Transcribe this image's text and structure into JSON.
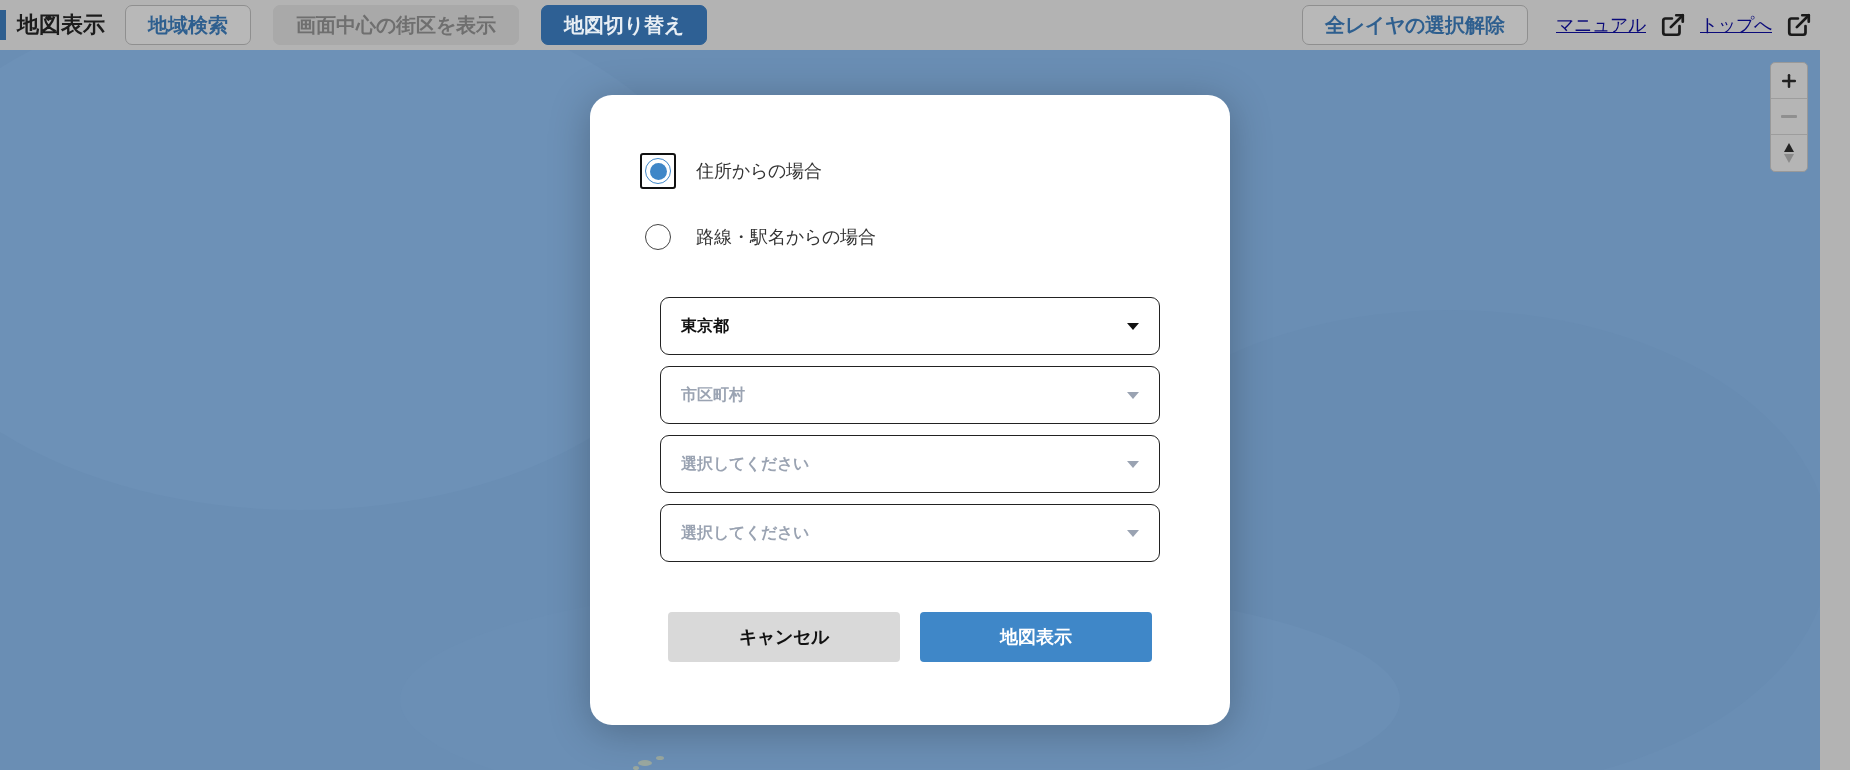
{
  "header": {
    "title": "地図表示",
    "buttons": [
      {
        "label": "地域検索",
        "kind": "outline",
        "disabled": false
      },
      {
        "label": "画面中心の街区を表示",
        "kind": "outline",
        "disabled": true
      },
      {
        "label": "地図切り替え",
        "kind": "primary",
        "disabled": false
      }
    ],
    "clear_button": "全レイヤの選択解除",
    "links": [
      {
        "label": "マニュアル"
      },
      {
        "label": "トップへ"
      }
    ]
  },
  "map": {
    "kind": "picture",
    "zoom_out_disabled": true
  },
  "dialog": {
    "options": [
      {
        "label": "住所からの場合",
        "selected": true
      },
      {
        "label": "路線・駅名からの場合",
        "selected": false
      }
    ],
    "selects": [
      {
        "value": "東京都"
      },
      {
        "placeholder": "市区町村"
      },
      {
        "placeholder": "選択してください"
      },
      {
        "placeholder": "選択してください"
      }
    ],
    "cancel": "キャンセル",
    "submit": "地図表示"
  }
}
